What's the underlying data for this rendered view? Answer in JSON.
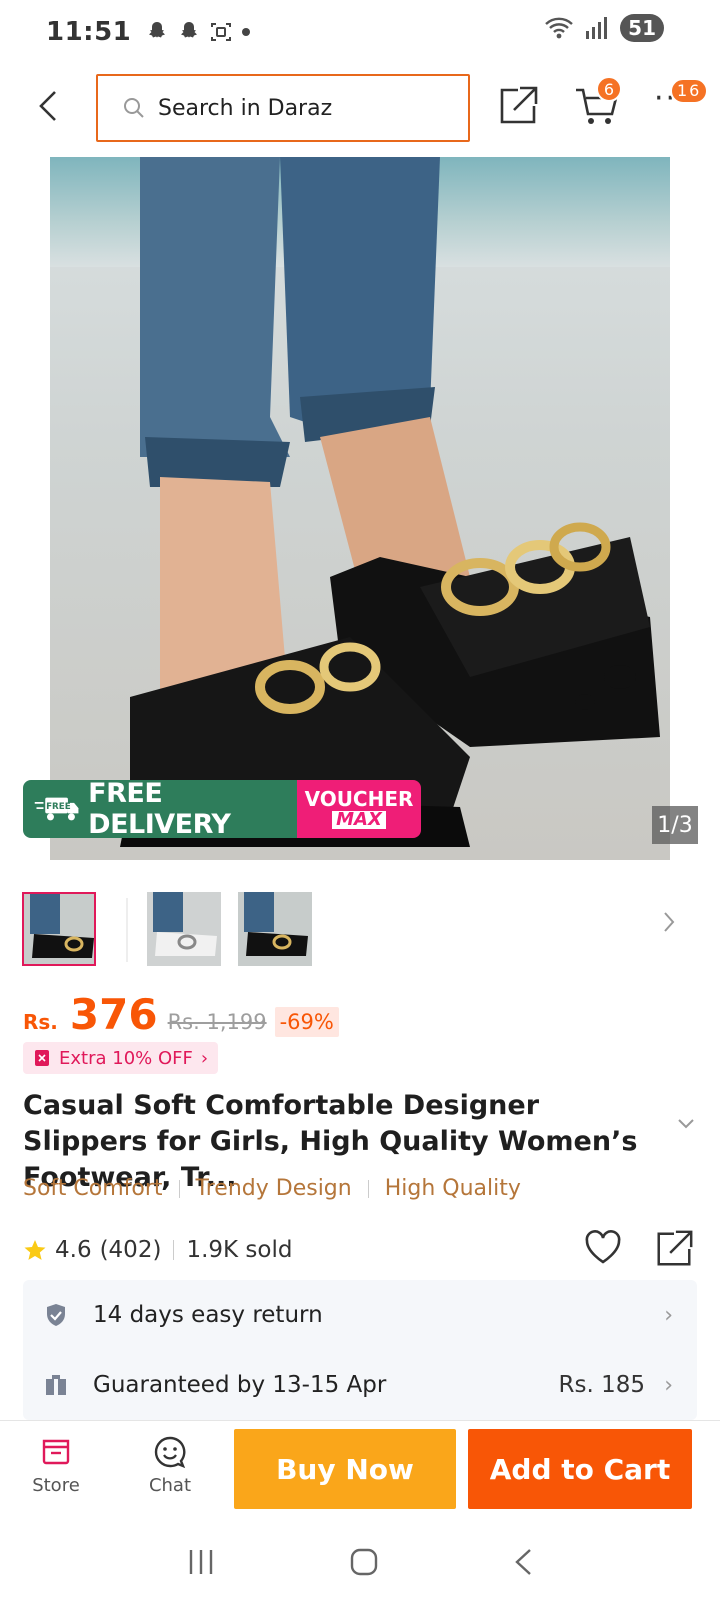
{
  "status_bar": {
    "time": "11:51",
    "battery": "51"
  },
  "header": {
    "search_placeholder": "Search in Daraz",
    "cart_count": "6",
    "more_count": "16"
  },
  "gallery": {
    "counter": "1/3",
    "promo_free": "FREE DELIVERY",
    "promo_free_small": "FREE",
    "voucher_top": "VOUCHER",
    "voucher_bottom": "MAX"
  },
  "product": {
    "currency": "Rs.",
    "price": "376",
    "old_price": "Rs. 1,199",
    "discount": "-69%",
    "extra_off": "Extra 10% OFF",
    "title": "Casual Soft Comfortable Designer Slippers for Girls, High Quality Women’s Footwear, Tr...",
    "tags": [
      "Soft Comfort",
      "Trendy Design",
      "High Quality"
    ],
    "rating": "4.6",
    "reviews": "(402)",
    "sold": "1.9K sold"
  },
  "services": {
    "return": "14 days easy return",
    "delivery": "Guaranteed by 13-15 Apr",
    "delivery_price": "Rs. 185"
  },
  "action_bar": {
    "store": "Store",
    "chat": "Chat",
    "buy_now": "Buy Now",
    "add_to_cart": "Add to Cart"
  },
  "colors": {
    "accent": "#f85606",
    "buy_now": "#faa61a",
    "free_delivery": "#2e7d5b",
    "voucher": "#ef1e77",
    "tag": "#b5763a"
  }
}
